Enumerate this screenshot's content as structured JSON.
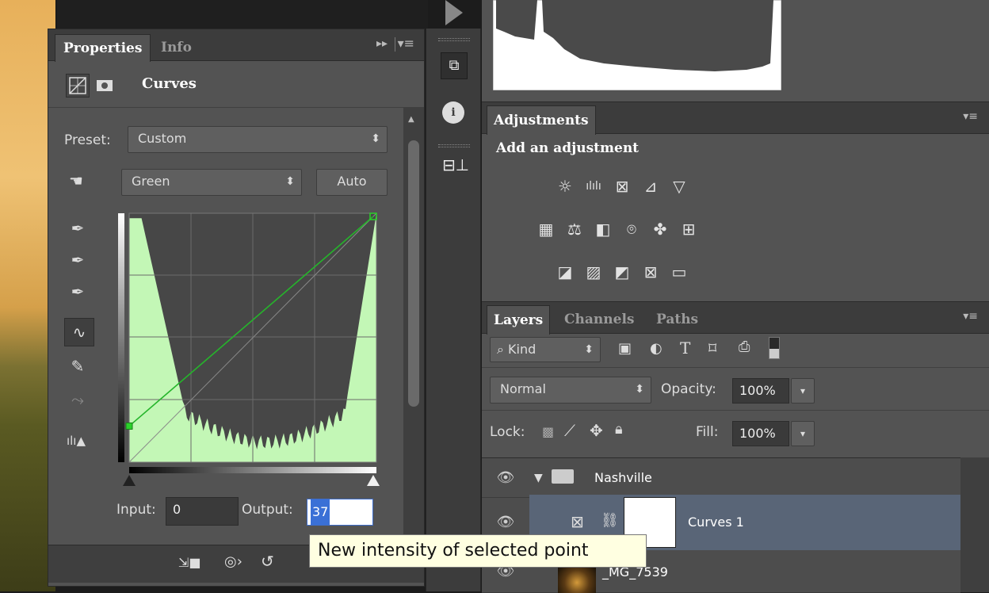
{
  "properties": {
    "tabs": [
      {
        "label": "Properties"
      },
      {
        "label": "Info"
      }
    ],
    "adjustment_name": "Curves",
    "preset_label": "Preset:",
    "preset_value": "Custom",
    "channel_value": "Green",
    "auto_label": "Auto",
    "input_label": "Input:",
    "input_value": "0",
    "output_label": "Output:",
    "output_value": "37"
  },
  "curve": {
    "point_input": 0,
    "point_output": 37,
    "curve_color": "#25b52b",
    "histogram_fill": "#c3f7b6"
  },
  "adjustments": {
    "tab_label": "Adjustments",
    "heading": "Add an adjustment"
  },
  "layers": {
    "tabs": [
      {
        "label": "Layers"
      },
      {
        "label": "Channels"
      },
      {
        "label": "Paths"
      }
    ],
    "filter_value": "Kind",
    "blend_mode": "Normal",
    "opacity_label": "Opacity:",
    "opacity_value": "100%",
    "lock_label": "Lock:",
    "fill_label": "Fill:",
    "fill_value": "100%",
    "rows": [
      {
        "name": "Nashville"
      },
      {
        "name": "Curves 1"
      },
      {
        "name": "_MG_7539"
      }
    ],
    "selected_row_color": "#596577"
  },
  "tooltip": {
    "text": "New intensity of selected point"
  }
}
